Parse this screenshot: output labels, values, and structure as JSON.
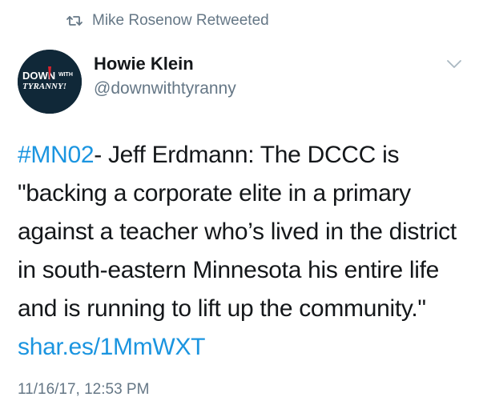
{
  "retweet": {
    "icon": "retweet-icon",
    "text": "Mike Rosenow Retweeted"
  },
  "author": {
    "name": "Howie Klein",
    "handle": "@downwithtyranny",
    "avatar_text_top": "DOWN",
    "avatar_text_small": "WITH",
    "avatar_text_bottom": "TYRANNY!"
  },
  "menu": {
    "icon": "chevron-down-icon"
  },
  "tweet": {
    "hashtag": "#MN02",
    "body": "- Jeff Erdmann: The DCCC is \"backing a corporate elite in a primary against a teacher who’s lived in the district in south-eastern Minnesota his entire life and is running to lift up the community.\"",
    "link": "shar.es/1MmWXT"
  },
  "timestamp": "11/16/17, 12:53 PM",
  "colors": {
    "link": "#1b95e0",
    "secondary_text": "#657786",
    "primary_text": "#14171a",
    "avatar_bg": "#102838",
    "avatar_accent": "#d9232d"
  }
}
